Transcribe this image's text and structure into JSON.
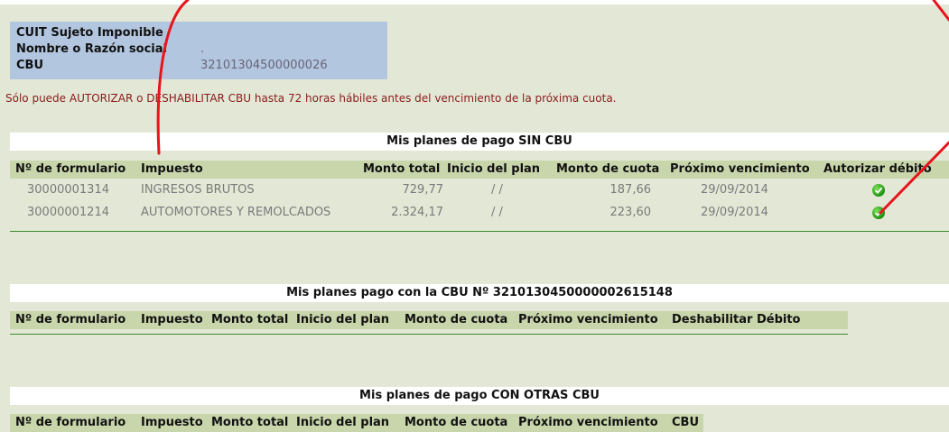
{
  "info": {
    "cuit_label": "CUIT Sujeto Imponible",
    "cuit_value": "",
    "nombre_label": "Nombre o Razón social",
    "nombre_value": ".",
    "cbu_label": "CBU",
    "cbu_value": "32101304500000026"
  },
  "notice": "Sólo puede AUTORIZAR o DESHABILITAR CBU hasta 72 horas hábiles antes del vencimiento de la próxima cuota.",
  "section1": {
    "title": "Mis planes de pago SIN CBU",
    "headers": [
      "Nº de formulario",
      "Impuesto",
      "Monto total",
      "Inicio del plan",
      "Monto de cuota",
      "Próximo vencimiento",
      "Autorizar débito"
    ],
    "rows": [
      {
        "formulario": "30000001314",
        "impuesto": "INGRESOS BRUTOS",
        "monto_total": "729,77",
        "inicio": "/ /",
        "cuota": "187,66",
        "vencimiento": "29/09/2014"
      },
      {
        "formulario": "30000001214",
        "impuesto": "AUTOMOTORES Y REMOLCADOS",
        "monto_total": "2.324,17",
        "inicio": "/ /",
        "cuota": "223,60",
        "vencimiento": "29/09/2014"
      }
    ]
  },
  "section2": {
    "title": "Mis planes pago con la CBU Nº 3210130450000002615148",
    "headers": [
      "Nº de formulario",
      "Impuesto",
      "Monto total",
      "Inicio del plan",
      "Monto de cuota",
      "Próximo vencimiento",
      "Deshabilitar Débito"
    ]
  },
  "section3": {
    "title": "Mis planes de pago CON OTRAS CBU",
    "headers": [
      "Nº de formulario",
      "Impuesto",
      "Monto total",
      "Inicio del plan",
      "Monto de cuota",
      "Próximo vencimiento",
      "CBU"
    ]
  },
  "icons": {
    "authorize": "green-check-icon"
  },
  "colors": {
    "annotation": "#e8141c",
    "header_bg": "#c9d6ac",
    "info_bg": "#b3c6df",
    "notice": "#8b1a1a"
  }
}
